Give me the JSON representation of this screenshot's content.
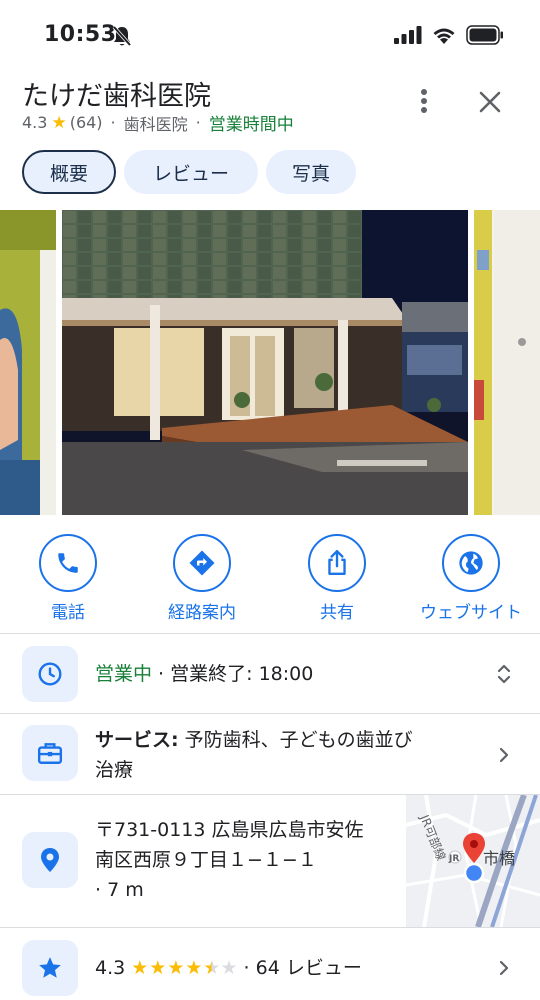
{
  "status_bar": {
    "time": "10:53"
  },
  "place": {
    "name": "たけだ歯科医院",
    "rating": "4.3",
    "star_glyph": "★",
    "review_count": "(64)",
    "separator": "·",
    "category": "歯科医院",
    "open_status": "営業時間中"
  },
  "tabs": [
    {
      "label": "概要",
      "selected": true
    },
    {
      "label": "レビュー",
      "selected": false
    },
    {
      "label": "写真",
      "selected": false
    }
  ],
  "actions": [
    {
      "label": "電話",
      "icon": "phone-icon"
    },
    {
      "label": "経路案内",
      "icon": "directions-icon"
    },
    {
      "label": "共有",
      "icon": "share-icon"
    },
    {
      "label": "ウェブサイト",
      "icon": "globe-icon"
    }
  ],
  "hours": {
    "status": "営業中",
    "separator": " · ",
    "closing": "営業終了: 18:00"
  },
  "services": {
    "label": "サービス:",
    "value_line1": "予防歯科、子どもの歯並び",
    "value_line2": "治療"
  },
  "address": {
    "line1": "〒731-0113 広島県広島市安佐",
    "line2": "南区西原９丁目１−１−１",
    "distance": "· 7 m",
    "map_labels": {
      "rail_line": "JR可部線",
      "station_jr": "JR",
      "station_name": "市橋"
    }
  },
  "reviews": {
    "rating": "4.3",
    "stars": "★★★★",
    "half_star": "★",
    "empty_star": "★",
    "rating_value": 4.3,
    "rating_max": 5,
    "separator": "·",
    "count_text": "64 レビュー"
  },
  "colors": {
    "accent_blue": "#1a73e8",
    "open_green": "#188038",
    "star_yellow": "#fbbc04",
    "chip_bg": "#e8f0fe",
    "chip_text": "#1b2f4a",
    "map_pin_red": "#ea4335"
  }
}
